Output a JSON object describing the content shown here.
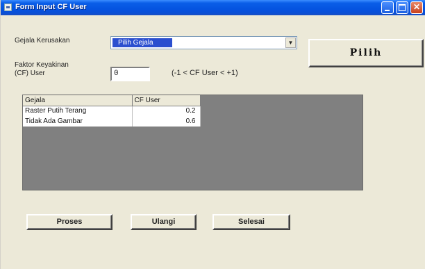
{
  "window": {
    "title": "Form Input CF User",
    "controls": {
      "minimize": "",
      "maximize": "",
      "close": "✕"
    }
  },
  "form": {
    "gejala_label": "Gejala Kerusakan",
    "gejala_select_value": "Pilih Gejala",
    "faktor_label_line1": "Faktor Keyakinan",
    "faktor_label_line2": "(CF) User",
    "cf_input_value": "0",
    "cf_range_hint": "(-1 < CF User < +1)",
    "pilih_button": "Pilih"
  },
  "table": {
    "headers": [
      "Gejala",
      "CF User"
    ],
    "rows": [
      {
        "gejala": "Raster Putih Terang",
        "cf": "0.2"
      },
      {
        "gejala": "Tidak Ada Gambar",
        "cf": "0.6"
      }
    ]
  },
  "buttons": {
    "proses": "Proses",
    "ulangi": "Ulangi",
    "selesai": "Selesai"
  },
  "colors": {
    "titlebar": "#0553e0",
    "selection": "#2b4fcf",
    "grid_bg": "#808080",
    "face": "#ece9d8"
  }
}
